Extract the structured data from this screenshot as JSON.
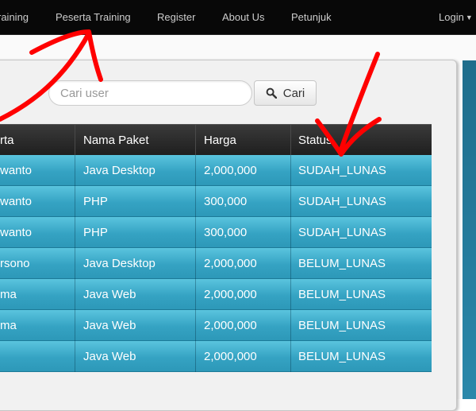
{
  "navbar": {
    "items": [
      "raining",
      "Peserta Training",
      "Register",
      "About Us",
      "Petunjuk"
    ],
    "login_label": "Login"
  },
  "search": {
    "placeholder": "Cari user",
    "button_label": "Cari"
  },
  "table": {
    "headers": [
      "rta",
      "Nama Paket",
      "Harga",
      "Status"
    ],
    "rows": [
      [
        "wanto",
        "Java Desktop",
        "2,000,000",
        "SUDAH_LUNAS"
      ],
      [
        "wanto",
        "PHP",
        "300,000",
        "SUDAH_LUNAS"
      ],
      [
        "wanto",
        "PHP",
        "300,000",
        "SUDAH_LUNAS"
      ],
      [
        "rsono",
        "Java Desktop",
        "2,000,000",
        "BELUM_LUNAS"
      ],
      [
        "ma",
        "Java Web",
        "2,000,000",
        "BELUM_LUNAS"
      ],
      [
        "ma",
        "Java Web",
        "2,000,000",
        "BELUM_LUNAS"
      ],
      [
        "",
        "Java Web",
        "2,000,000",
        "BELUM_LUNAS"
      ]
    ]
  },
  "colors": {
    "navbar_bg": "#080808",
    "row_accent": "#35a3c3",
    "annotation_red": "#ff0000"
  },
  "icons": {
    "search": "magnifier-icon",
    "login_caret": "caret-down-icon"
  }
}
